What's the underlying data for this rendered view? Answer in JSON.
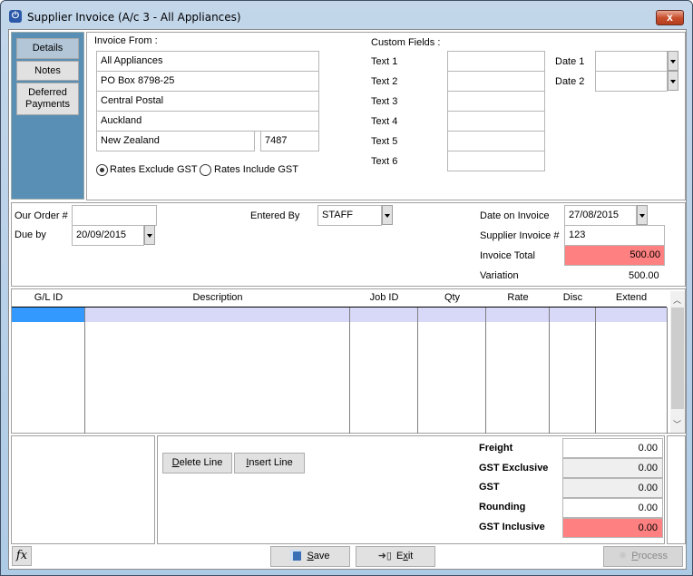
{
  "window": {
    "title": "Supplier Invoice (A/c 3 - All Appliances)",
    "close_label": "x"
  },
  "sidebar": {
    "items": [
      {
        "label": "Details",
        "active": true
      },
      {
        "label": "Notes",
        "active": false
      },
      {
        "label": "Deferred Payments",
        "active": false
      }
    ]
  },
  "invoice_from": {
    "heading": "Invoice From :",
    "lines": [
      "All Appliances",
      "PO Box 8798-25",
      "Central Postal",
      "Auckland",
      "New Zealand"
    ],
    "postcode": "7487",
    "rates_options": [
      {
        "label": "Rates Exclude GST",
        "selected": true
      },
      {
        "label": "Rates Include GST",
        "selected": false
      }
    ]
  },
  "custom_fields": {
    "heading": "Custom Fields  :",
    "texts": [
      {
        "label": "Text 1",
        "value": ""
      },
      {
        "label": "Text 2",
        "value": ""
      },
      {
        "label": "Text 3",
        "value": ""
      },
      {
        "label": "Text 4",
        "value": ""
      },
      {
        "label": "Text 5",
        "value": ""
      },
      {
        "label": "Text 6",
        "value": ""
      }
    ],
    "dates": [
      {
        "label": "Date 1",
        "value": ""
      },
      {
        "label": "Date 2",
        "value": ""
      }
    ]
  },
  "order": {
    "our_order_label": "Our Order #",
    "our_order_value": "",
    "due_by_label": "Due by",
    "due_by_value": "20/09/2015",
    "entered_by_label": "Entered By",
    "entered_by_value": "STAFF",
    "date_on_invoice_label": "Date on Invoice",
    "date_on_invoice_value": "27/08/2015",
    "supplier_invoice_label": "Supplier Invoice #",
    "supplier_invoice_value": "123",
    "invoice_total_label": "Invoice Total",
    "invoice_total_value": "500.00",
    "variation_label": "Variation",
    "variation_value": "500.00"
  },
  "grid": {
    "columns": [
      "G/L ID",
      "Description",
      "Job ID",
      "Qty",
      "Rate",
      "Disc",
      "Extend"
    ],
    "rows": [
      [
        "",
        "",
        "",
        "",
        "",
        "",
        ""
      ]
    ]
  },
  "line_buttons": {
    "delete": "Delete Line",
    "delete_accel": "D",
    "delete_rest": "elete Line",
    "insert_accel": "I",
    "insert_rest": "nsert Line"
  },
  "totals": [
    {
      "label": "Freight",
      "value": "0.00",
      "style": "white"
    },
    {
      "label": "GST Exclusive",
      "value": "0.00",
      "style": "grey"
    },
    {
      "label": "GST",
      "value": "0.00",
      "style": "grey"
    },
    {
      "label": "Rounding",
      "value": "0.00",
      "style": "white"
    },
    {
      "label": "GST Inclusive",
      "value": "0.00",
      "style": "red"
    }
  ],
  "footer": {
    "fx_label": "fx",
    "save_accel": "S",
    "save_rest": "ave",
    "exit_pre": "E",
    "exit_accel": "x",
    "exit_rest": "it",
    "process_accel": "P",
    "process_rest": "rocess"
  },
  "colors": {
    "highlight_red": "#ff8080",
    "selected_row": "#d8d8f8",
    "selected_cell": "#3399ff",
    "sidebar_bg": "#5a8fb5"
  }
}
